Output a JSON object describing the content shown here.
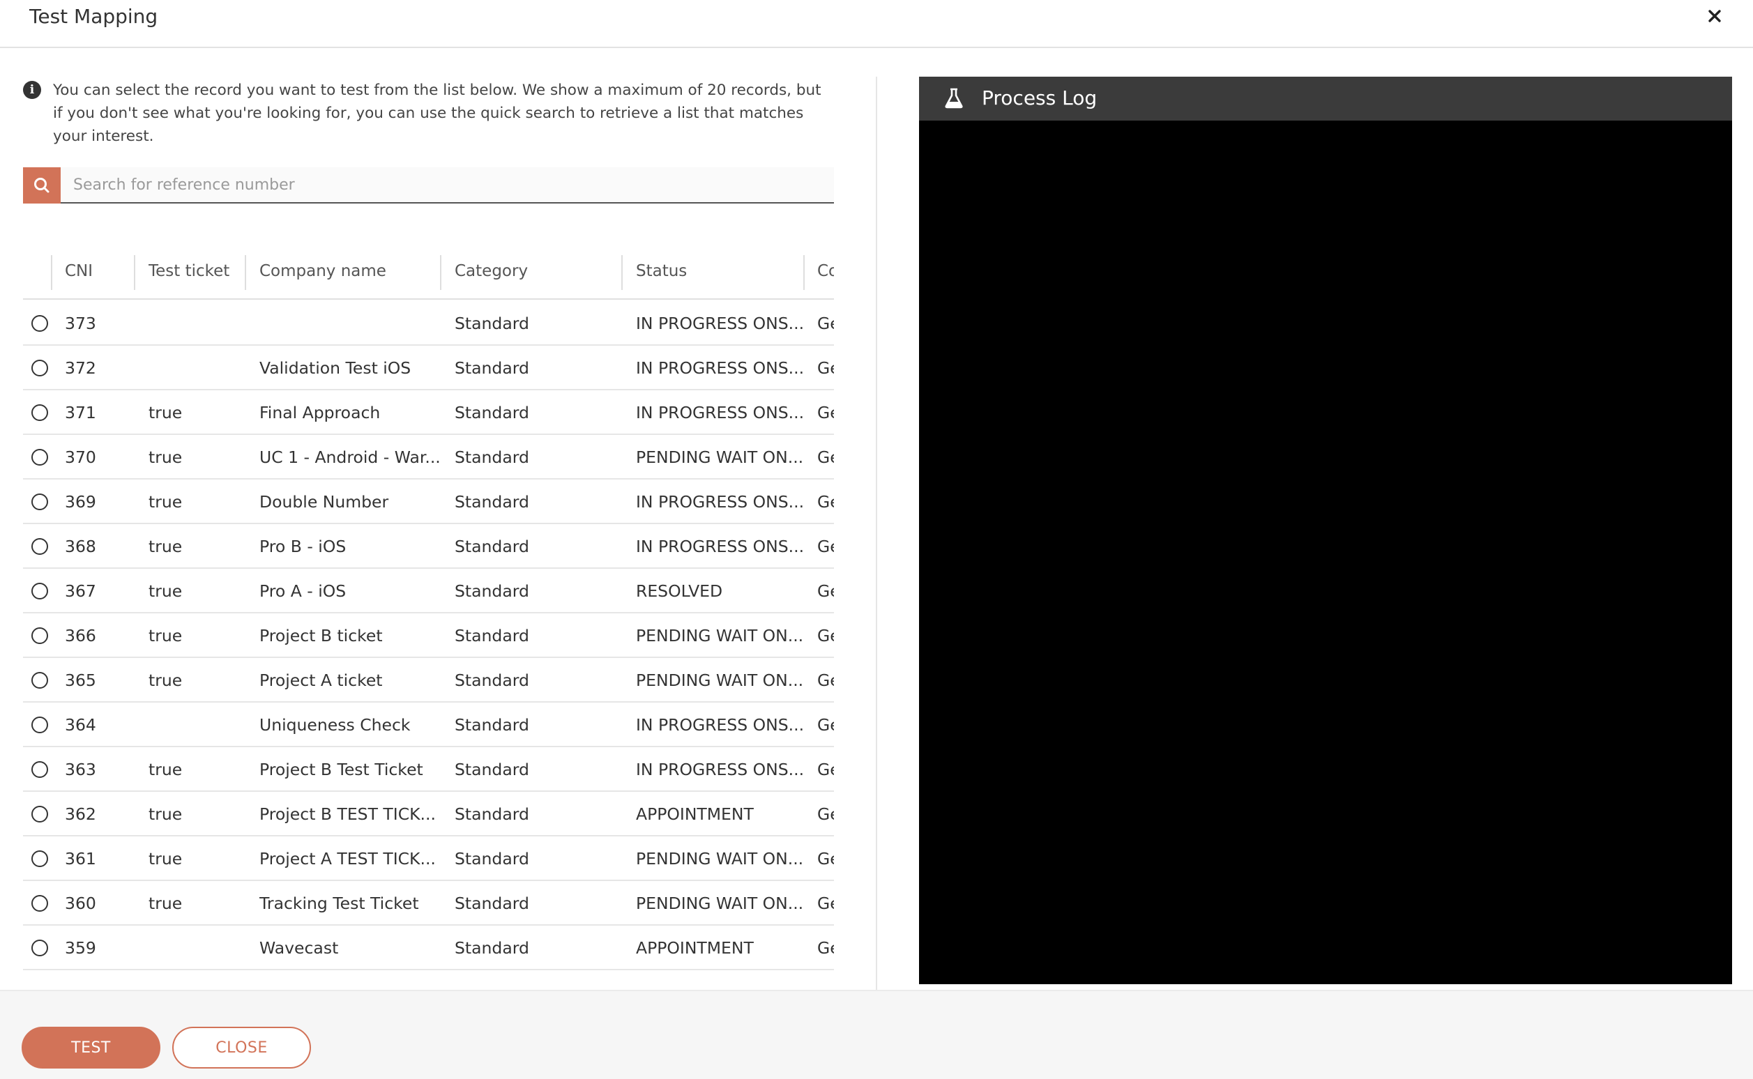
{
  "dialog": {
    "title": "Test Mapping",
    "close_icon": "close-icon"
  },
  "info": {
    "icon": "info-icon",
    "text": "You can select the record you want to test from the list below. We show a maximum of 20 records, but if you don't see what you're looking for, you can use the quick search to retrieve a list that matches your interest."
  },
  "search": {
    "icon": "search-icon",
    "placeholder": "Search for reference number",
    "value": ""
  },
  "table": {
    "columns": [
      "CNI",
      "Test ticket",
      "Company name",
      "Category",
      "Status",
      "Co"
    ],
    "rows": [
      {
        "cni": "373",
        "test_ticket": "",
        "company": "",
        "category": "Standard",
        "status": "IN PROGRESS ONS...",
        "extra": "Ge"
      },
      {
        "cni": "372",
        "test_ticket": "",
        "company": "Validation Test iOS",
        "category": "Standard",
        "status": "IN PROGRESS ONS...",
        "extra": "Ge"
      },
      {
        "cni": "371",
        "test_ticket": "true",
        "company": "Final Approach",
        "category": "Standard",
        "status": "IN PROGRESS ONS...",
        "extra": "Ge"
      },
      {
        "cni": "370",
        "test_ticket": "true",
        "company": "UC 1 - Android - War...",
        "category": "Standard",
        "status": "PENDING WAIT ON...",
        "extra": "Ge"
      },
      {
        "cni": "369",
        "test_ticket": "true",
        "company": "Double Number",
        "category": "Standard",
        "status": "IN PROGRESS ONS...",
        "extra": "Ge"
      },
      {
        "cni": "368",
        "test_ticket": "true",
        "company": "Pro B - iOS",
        "category": "Standard",
        "status": "IN PROGRESS ONS...",
        "extra": "Ge"
      },
      {
        "cni": "367",
        "test_ticket": "true",
        "company": "Pro A - iOS",
        "category": "Standard",
        "status": "RESOLVED",
        "extra": "Ge"
      },
      {
        "cni": "366",
        "test_ticket": "true",
        "company": "Project B ticket",
        "category": "Standard",
        "status": "PENDING WAIT ON...",
        "extra": "Ge"
      },
      {
        "cni": "365",
        "test_ticket": "true",
        "company": "Project A ticket",
        "category": "Standard",
        "status": "PENDING WAIT ON...",
        "extra": "Ge"
      },
      {
        "cni": "364",
        "test_ticket": "",
        "company": "Uniqueness Check",
        "category": "Standard",
        "status": "IN PROGRESS ONS...",
        "extra": "Ge"
      },
      {
        "cni": "363",
        "test_ticket": "true",
        "company": "Project B Test Ticket",
        "category": "Standard",
        "status": "IN PROGRESS ONS...",
        "extra": "Ge"
      },
      {
        "cni": "362",
        "test_ticket": "true",
        "company": "Project B TEST TICK...",
        "category": "Standard",
        "status": "APPOINTMENT",
        "extra": "Ge"
      },
      {
        "cni": "361",
        "test_ticket": "true",
        "company": "Project A TEST TICK...",
        "category": "Standard",
        "status": "PENDING WAIT ON...",
        "extra": "Ge"
      },
      {
        "cni": "360",
        "test_ticket": "true",
        "company": "Tracking Test Ticket",
        "category": "Standard",
        "status": "PENDING WAIT ON...",
        "extra": "Ge"
      },
      {
        "cni": "359",
        "test_ticket": "",
        "company": "Wavecast",
        "category": "Standard",
        "status": "APPOINTMENT",
        "extra": "Ge"
      }
    ]
  },
  "process_log": {
    "icon": "flask-icon",
    "title": "Process Log"
  },
  "footer": {
    "test_label": "TEST",
    "close_label": "CLOSE"
  },
  "colors": {
    "accent": "#d27358",
    "log_header": "#3b3b3b",
    "log_body": "#000000"
  }
}
